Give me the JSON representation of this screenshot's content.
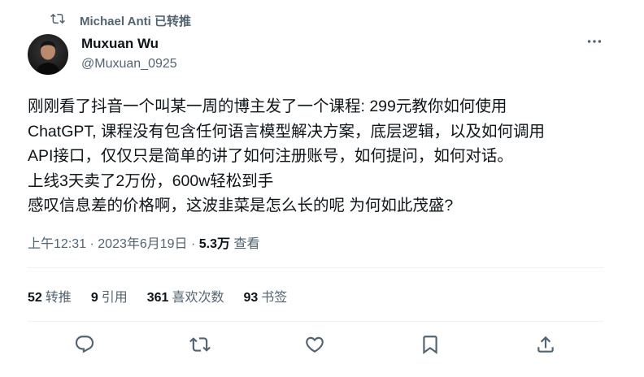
{
  "retweet": {
    "icon": "retweet-icon",
    "text": "Michael Anti 已转推"
  },
  "author": {
    "avatar": "avatar-photo",
    "name": "Muxuan Wu",
    "handle": "@Muxuan_0925"
  },
  "more_icon": "more-icon",
  "tweet": {
    "lines": [
      "刚刚看了抖音一个叫某一周的博主发了一个课程: 299元教你如何使用",
      "ChatGPT, 课程没有包含任何语言模型解决方案，底层逻辑，以及如何调用",
      "API接口，仅仅只是简单的讲了如何注册账号，如何提问，如何对话。",
      "上线3天卖了2万份，600w轻松到手",
      "感叹信息差的价格啊，这波韭菜是怎么长的呢 为何如此茂盛?"
    ]
  },
  "meta": {
    "time": "上午12:31",
    "sep1": " · ",
    "date": "2023年6月19日",
    "sep2": " · ",
    "views_count": "5.3万",
    "views_label": "查看"
  },
  "stats": [
    {
      "num": "52",
      "label": "转推"
    },
    {
      "num": "9",
      "label": "引用"
    },
    {
      "num": "361",
      "label": "喜欢次数"
    },
    {
      "num": "93",
      "label": "书签"
    }
  ],
  "actions": [
    "reply-icon",
    "retweet-icon",
    "like-icon",
    "bookmark-icon",
    "share-icon"
  ],
  "colors": {
    "text": "#0f1419",
    "secondary": "#536471",
    "divider": "#eff3f4"
  }
}
